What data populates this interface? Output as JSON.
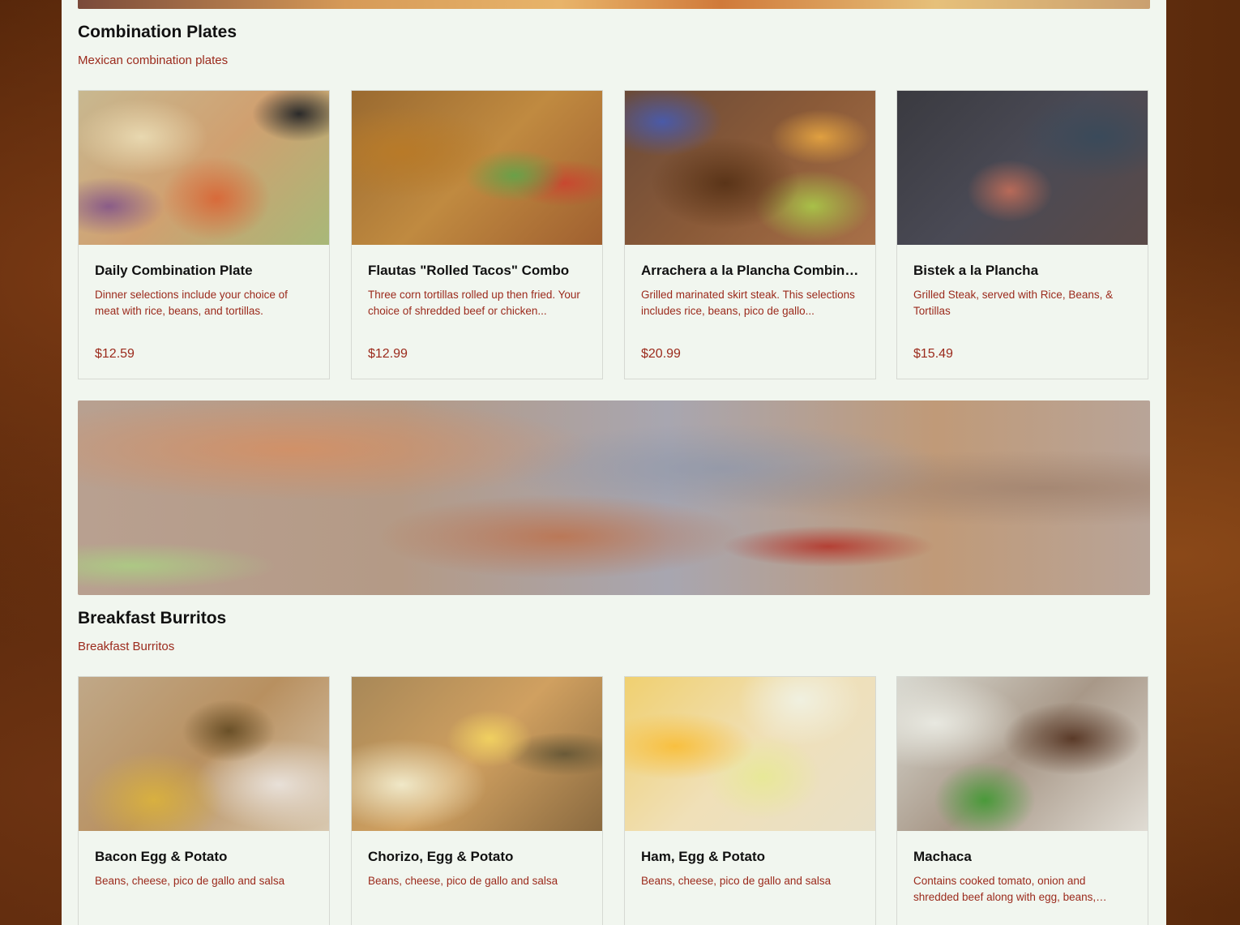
{
  "sections": [
    {
      "title": "Combination Plates",
      "subtitle": "Mexican combination plates",
      "items": [
        {
          "name": "Daily Combination Plate",
          "description": "Dinner selections include your choice of meat with rice, beans, and tortillas.",
          "price": "$12.59"
        },
        {
          "name": "Flautas \"Rolled Tacos\" Combo",
          "description": "Three corn tortillas rolled up then fried. Your choice of shredded beef or chicken...",
          "price": "$12.99"
        },
        {
          "name": "Arrachera a la Plancha Combination",
          "description": "Grilled marinated skirt steak. This selections includes rice, beans, pico de gallo...",
          "price": "$20.99"
        },
        {
          "name": "Bistek a la Plancha",
          "description": "Grilled Steak, served with Rice, Beans, & Tortillas",
          "price": "$15.49"
        }
      ]
    },
    {
      "title": "Breakfast Burritos",
      "subtitle": "Breakfast Burritos",
      "items": [
        {
          "name": "Bacon Egg & Potato",
          "description": "Beans, cheese, pico de gallo and salsa",
          "price": ""
        },
        {
          "name": "Chorizo, Egg & Potato",
          "description": "Beans, cheese, pico de gallo and salsa",
          "price": ""
        },
        {
          "name": "Ham, Egg & Potato",
          "description": "Beans, cheese, pico de gallo and salsa",
          "price": ""
        },
        {
          "name": "Machaca",
          "description": "Contains cooked tomato, onion and shredded beef along with egg, beans, cheese...",
          "price": ""
        }
      ]
    }
  ],
  "colors": {
    "accent": "#9b2a1c",
    "panel": "#f1f6ef",
    "background": "#5a2a0c"
  }
}
